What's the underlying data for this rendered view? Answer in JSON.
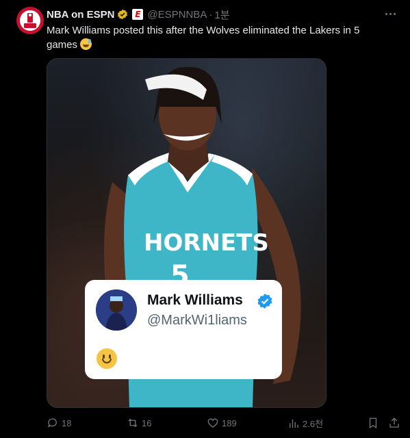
{
  "author": {
    "name": "NBA on ESPN",
    "handle": "@ESPNNBA",
    "separator": "·",
    "time": "1분",
    "avatar_text": "NBA ESPN",
    "affiliate_badge": "E"
  },
  "tweet": {
    "text": "Mark Williams posted this after the Wolves eliminated the Lakers in 5 games",
    "emoji": "sweat-smile-emoji"
  },
  "media": {
    "jersey_text": "HORNETS",
    "jersey_number": "5",
    "embedded_post": {
      "name": "Mark Williams",
      "handle": "@MarkWi1liams",
      "body_emoji": "slightly-smiling-face"
    }
  },
  "actions": {
    "replies": "18",
    "retweets": "16",
    "likes": "189",
    "views": "2.6천"
  },
  "colors": {
    "background": "#000000",
    "text": "#e7e9ea",
    "muted": "#71767b",
    "verified_gold": "#e2b719",
    "verified_blue": "#1d9bf0",
    "jersey_teal": "#3fb6c7"
  }
}
